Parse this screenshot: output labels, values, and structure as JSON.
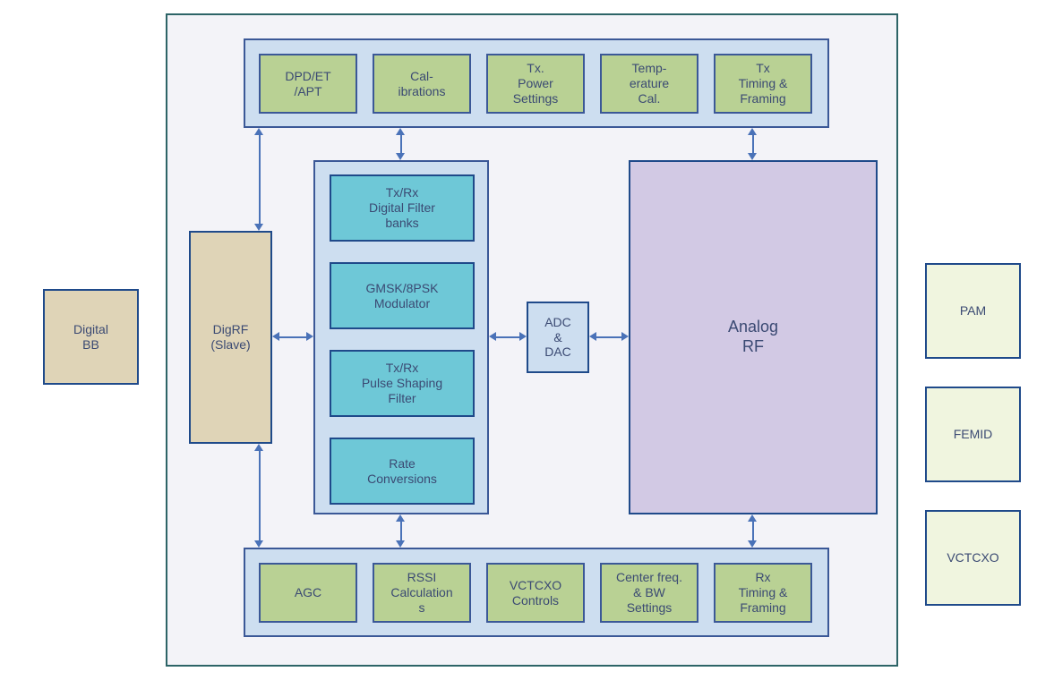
{
  "external": {
    "digital_bb": "Digital\nBB",
    "pam": "PAM",
    "femid": "FEMID",
    "vctcxo": "VCTCXO"
  },
  "digrf": "DigRF\n(Slave)",
  "top_group": {
    "items": [
      "DPD/ET\n/APT",
      "Cal-\nibrations",
      "Tx.\nPower\nSettings",
      "Temp-\nerature\nCal.",
      "Tx\nTiming &\nFraming"
    ]
  },
  "bottom_group": {
    "items": [
      "AGC",
      "RSSI\nCalculation\ns",
      "VCTCXO\nControls",
      "Center freq.\n& BW\nSettings",
      "Rx\nTiming &\nFraming"
    ]
  },
  "dsp": {
    "items": [
      "Tx/Rx\nDigital Filter\nbanks",
      "GMSK/8PSK\nModulator",
      "Tx/Rx\nPulse Shaping\nFilter",
      "Rate\nConversions"
    ]
  },
  "adc_dac": "ADC\n&\nDAC",
  "analog_rf": "Analog\nRF"
}
